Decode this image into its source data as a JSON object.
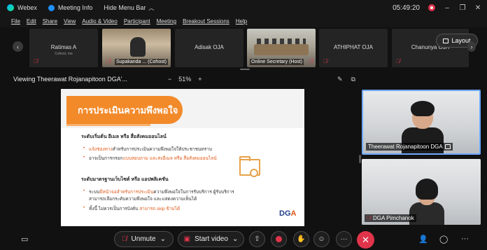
{
  "titlebar": {
    "app": "Webex",
    "meeting_info": "Meeting Info",
    "hide_menu": "Hide Menu Bar",
    "time": "05:49:20",
    "minimize": "–",
    "restore": "❐",
    "close": "✕"
  },
  "menu": [
    "File",
    "Edit",
    "Share",
    "View",
    "Audio & Video",
    "Participant",
    "Meeting",
    "Breakout Sessions",
    "Help"
  ],
  "filmstrip": {
    "tiles": [
      {
        "name": "Ratimas A",
        "sub": "Cohost, me",
        "label": ""
      },
      {
        "name": "",
        "sub": "",
        "label": "Supakanda ... (Cohost)"
      },
      {
        "name": "Adisak OJA",
        "sub": "",
        "label": ""
      },
      {
        "name": "",
        "sub": "",
        "label": "Online Secretary (Host)"
      },
      {
        "name": "ATHIPHAT OJA",
        "sub": "",
        "label": ""
      },
      {
        "name": "Chanunya OJA",
        "sub": "",
        "label": ""
      }
    ],
    "layout_label": "Layout"
  },
  "share": {
    "viewing": "Viewing Theerawat Rojanapitoon DGA'...",
    "zoom_out": "−",
    "zoom": "51%",
    "zoom_in": "+"
  },
  "slide": {
    "title": "การประเมินความพึงพอใจ",
    "section1": "ระดับเริ่มต้น อีเมล หรือ สื่อสังคมออนไลน์",
    "s1_b1_hl": "แจ้งช่องทาง",
    "s1_b1": "สำหรับการประเมินความพึงพอใจให้ประชาชนทราบ",
    "s1_b2": "อาจเป็นการกรอก",
    "s1_b2_hl": "แบบสอบถาม และส่งอีเมล หรือ สื่อสังคมออนไลน์",
    "section2": "ระดับมาตรฐานเว็บไซต์ หรือ แอปพลิเคชัน",
    "s2_b1": "ระบบ",
    "s2_b1_hl": "มีหน้าจอสำหรับการประเมิน",
    "s2_b1_rest": "ความพึงพอใจในการรับบริการ ผู้รับบริการสามารถเลือกระดับความพึงพอใจ และแสดงความเห็นได้",
    "s2_b2": "ทั้งนี้ ไม่ควรเป็นการบังคับ",
    "s2_b2_hl": "สามารถ skip ข้ามได้",
    "logo_d": "DG",
    "logo_a": "A"
  },
  "videos": [
    {
      "name": "Theerawat Rojanapitoon DGA"
    },
    {
      "name": "DGA Pimchanok"
    }
  ],
  "toolbar": {
    "unmute": "Unmute",
    "start_video": "Start video",
    "more": "···",
    "end": "✕"
  }
}
